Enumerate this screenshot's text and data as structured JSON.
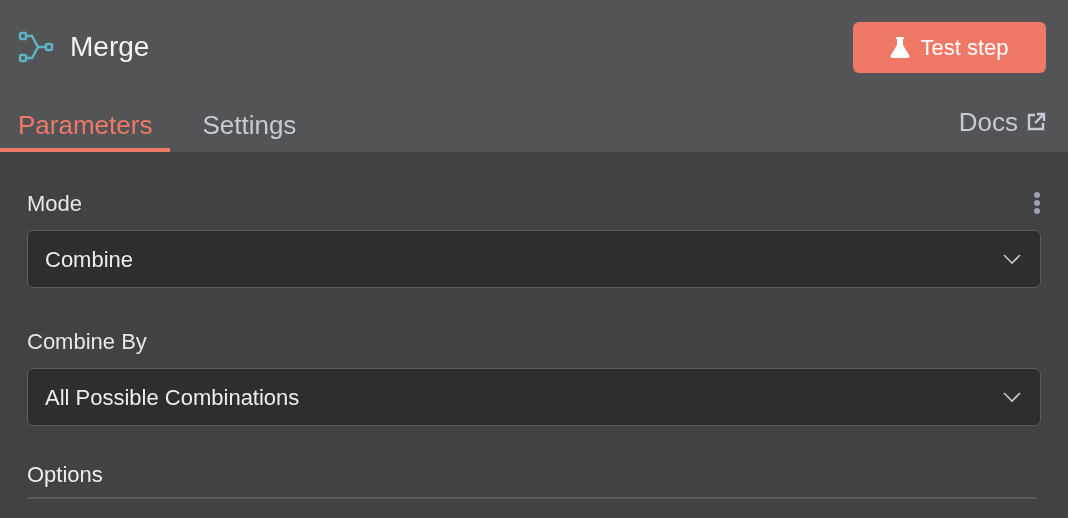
{
  "header": {
    "title": "Merge",
    "test_button": "Test step"
  },
  "tabs": [
    {
      "label": "Parameters",
      "selected": true
    },
    {
      "label": "Settings",
      "selected": false
    }
  ],
  "docs_link": "Docs",
  "fields": [
    {
      "label": "Mode",
      "value": "Combine",
      "has_menu": true
    },
    {
      "label": "Combine By",
      "value": "All Possible Combinations",
      "has_menu": false
    }
  ],
  "options_heading": "Options"
}
